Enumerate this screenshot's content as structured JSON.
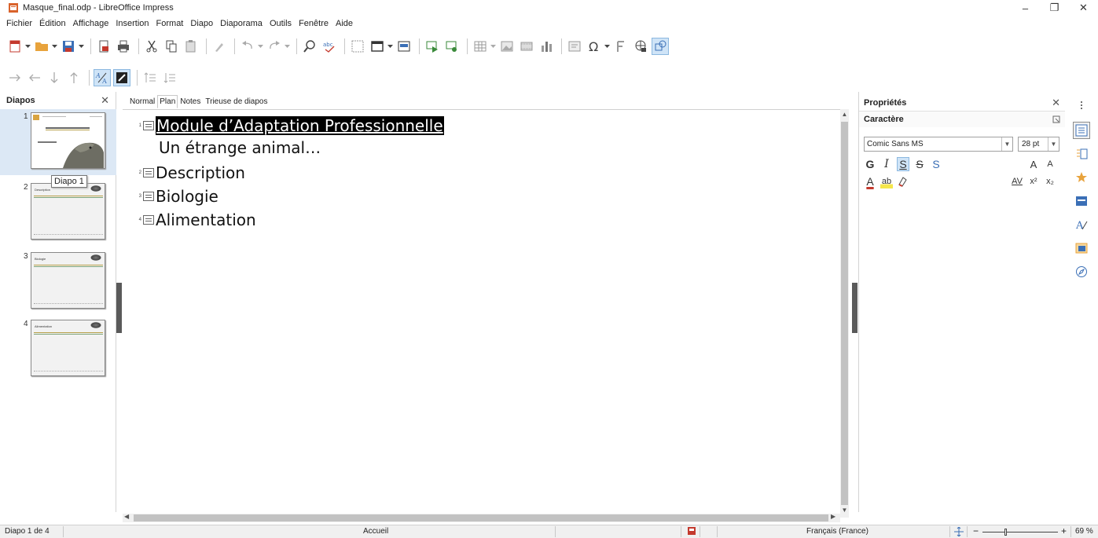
{
  "window": {
    "title": "Masque_final.odp - LibreOffice Impress",
    "controls": {
      "minimize": "–",
      "maximize": "❐",
      "close": "✕"
    }
  },
  "menu": [
    {
      "label": "Fichier"
    },
    {
      "label": "Édition"
    },
    {
      "label": "Affichage"
    },
    {
      "label": "Insertion"
    },
    {
      "label": "Format"
    },
    {
      "label": "Diapo"
    },
    {
      "label": "Diaporama"
    },
    {
      "label": "Outils"
    },
    {
      "label": "Fenêtre"
    },
    {
      "label": "Aide"
    }
  ],
  "slides_pane": {
    "title": "Diapos",
    "close": "✕",
    "tooltip": "Diapo 1",
    "slides": [
      {
        "number": "1",
        "title": "Module d'Adaptation Professionnelle",
        "subtitle": "Un étrange animal",
        "selected": true
      },
      {
        "number": "2",
        "title": "Description",
        "selected": false
      },
      {
        "number": "3",
        "title": "Biologie",
        "selected": false
      },
      {
        "number": "4",
        "title": "Alimentation",
        "selected": false
      }
    ]
  },
  "view_tabs": [
    {
      "label": "Normal",
      "active": false
    },
    {
      "label": "Plan",
      "active": true
    },
    {
      "label": "Notes",
      "active": false
    },
    {
      "label": "Trieuse de diapos",
      "active": false
    }
  ],
  "outline": [
    {
      "number": "1",
      "text": "Module d’Adaptation Professionnelle",
      "selected": true,
      "sub": "Un étrange animal…"
    },
    {
      "number": "2",
      "text": "Description",
      "selected": false
    },
    {
      "number": "3",
      "text": "Biologie",
      "selected": false
    },
    {
      "number": "4",
      "text": "Alimentation",
      "selected": false
    }
  ],
  "sidebar": {
    "title": "Propriétés",
    "close": "✕",
    "section": "Caractère",
    "font_name": "Comic Sans MS",
    "font_size": "28 pt",
    "format_buttons": {
      "bold": "G",
      "italic": "I",
      "underline": "S",
      "strike": "S",
      "shadow": "S",
      "grow": "A",
      "shrink": "A",
      "font_color": "A",
      "highlight": "ab",
      "spacing": "AV",
      "superscript": "x²",
      "subscript": "x₂"
    }
  },
  "status": {
    "slide": "Diapo 1 de 4",
    "layout": "Accueil",
    "language": "Français (France)",
    "zoom": "69 %",
    "zoom_minus": "−",
    "zoom_plus": "+"
  },
  "colors": {
    "accent": "#cfe4f7",
    "selection_bg": "#000000",
    "doc_red": "#c4392d",
    "folder_orange": "#e8a33c"
  }
}
